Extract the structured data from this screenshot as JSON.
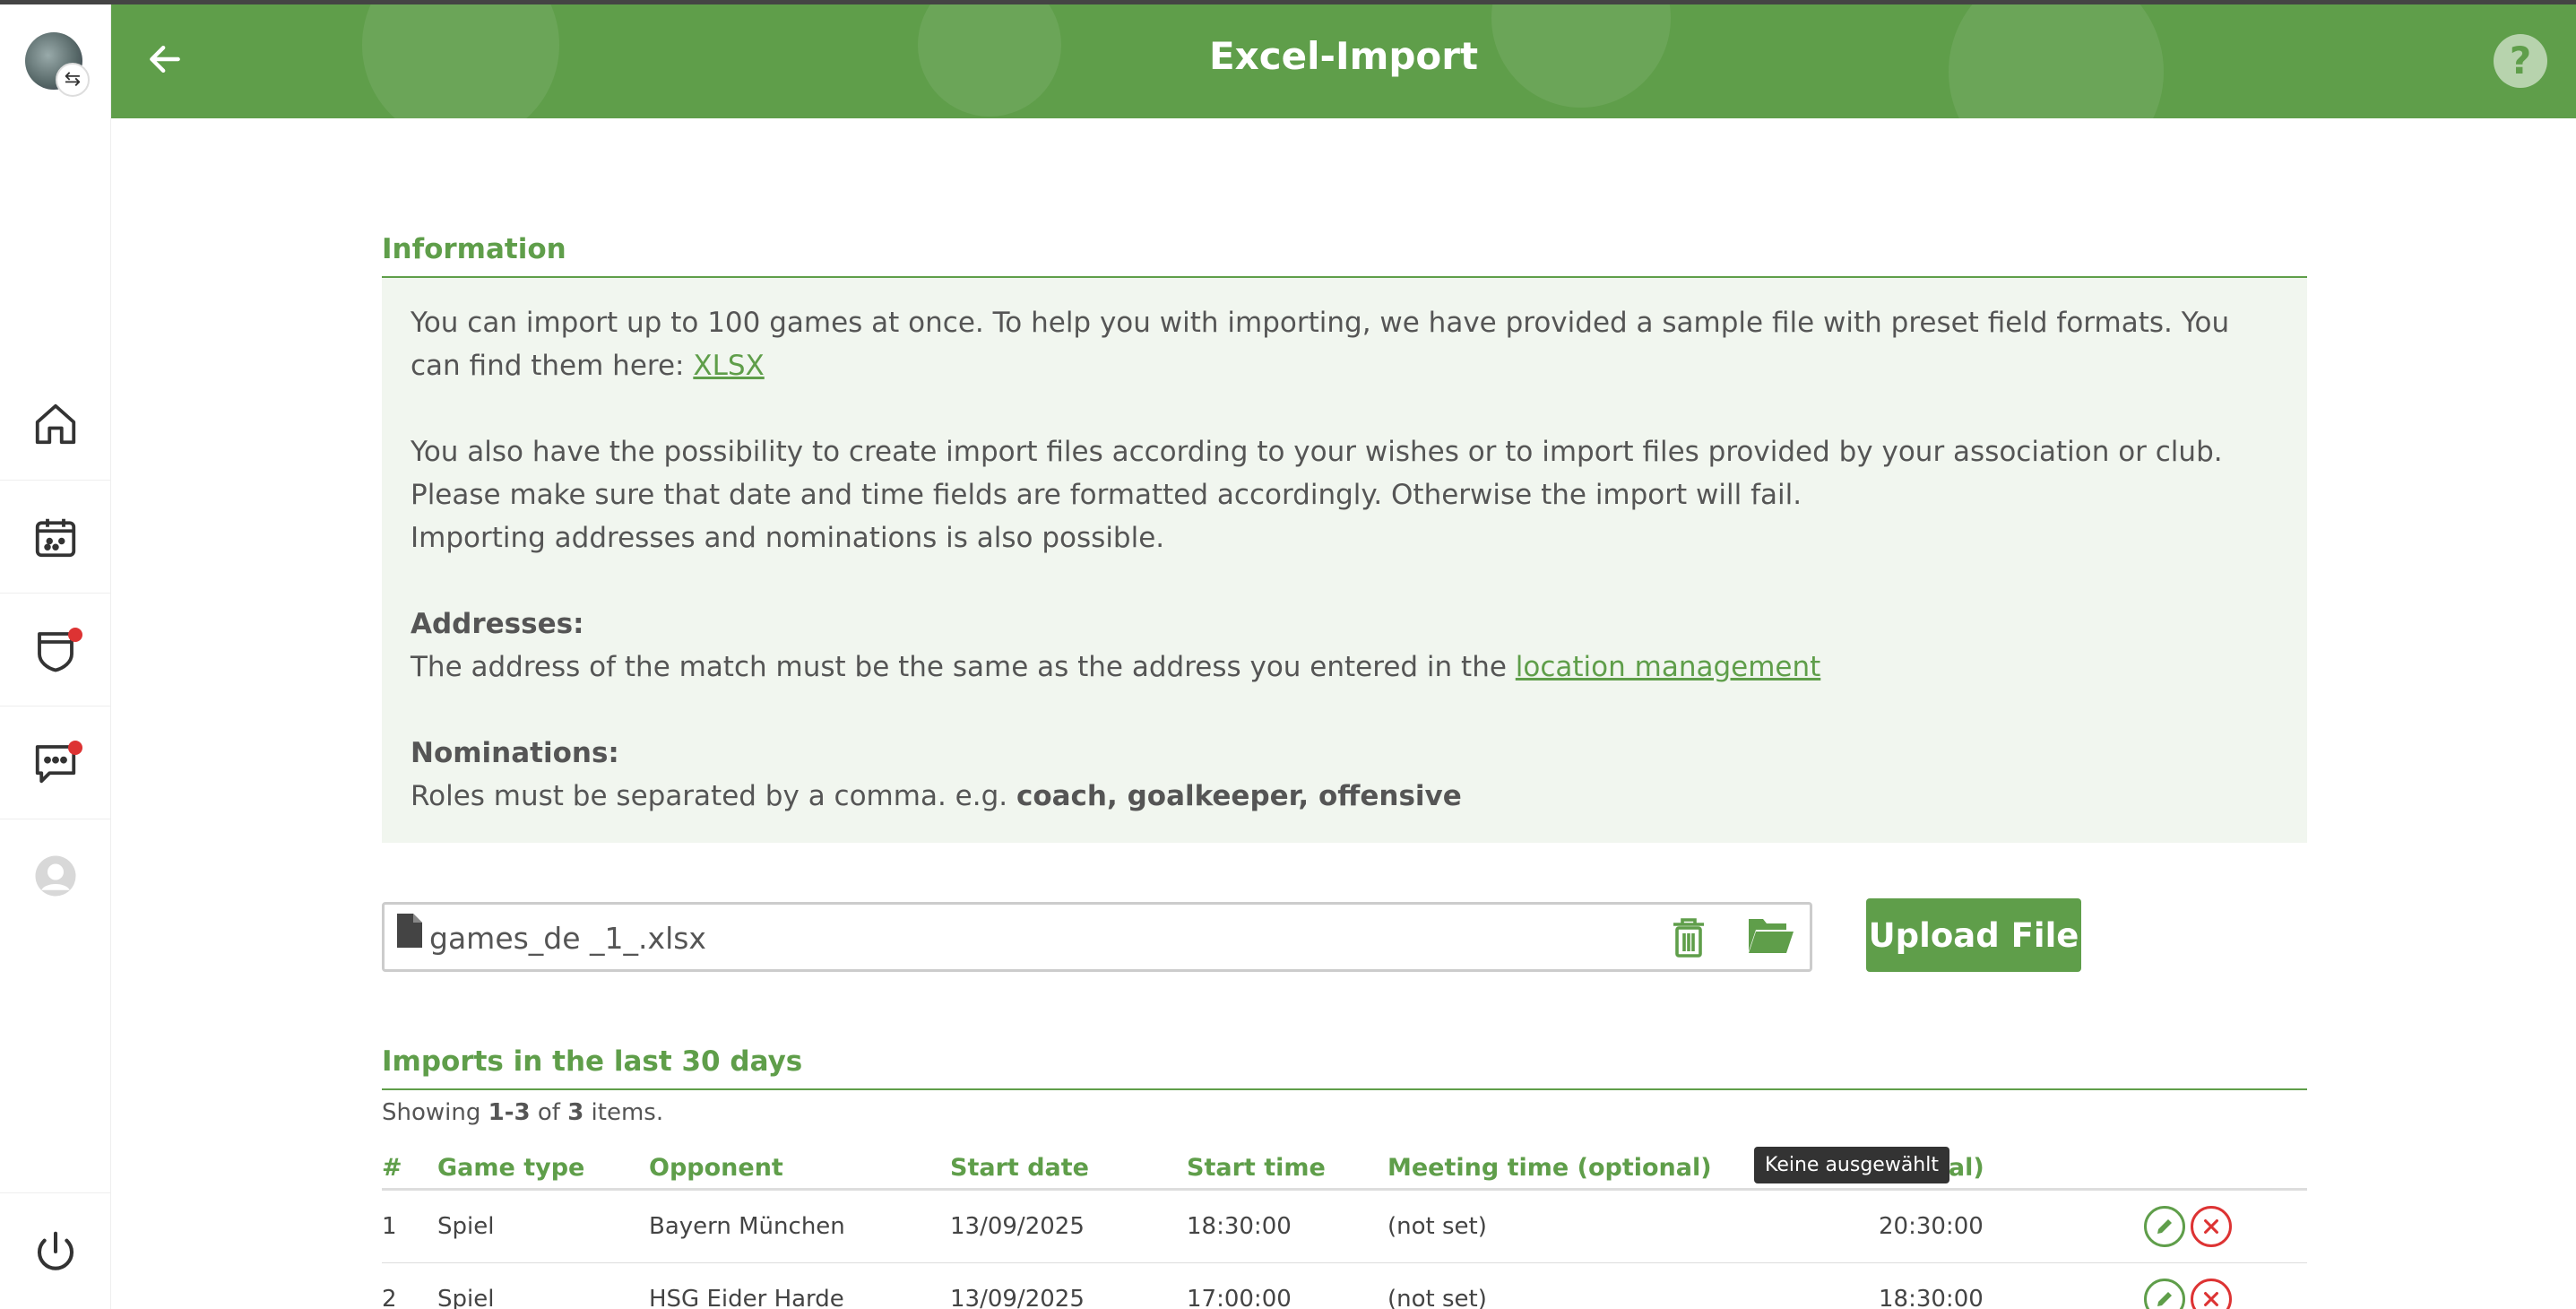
{
  "header": {
    "title": "Excel-Import",
    "help_label": "?"
  },
  "sidebar": {
    "swap_glyph": "⇆"
  },
  "info": {
    "title": "Information",
    "p1_text": "You can import up to 100 games at once. To help you with importing, we have provided a sample file with preset field formats. You can find them here: ",
    "p1_link": "XLSX",
    "p2": "You also have the possibility to create import files according to your wishes or to import files provided by your association or club. Please make sure that date and time fields are formatted accordingly. Otherwise the import will fail.",
    "p3": "Importing addresses and nominations is also possible.",
    "addresses_label": "Addresses:",
    "addresses_text": "The address of the match must be the same as the address you entered in the ",
    "addresses_link": "location management",
    "nominations_label": "Nominations:",
    "nominations_text": "Roles must be separated by a comma. e.g. ",
    "nominations_example": "coach, goalkeeper, offensive"
  },
  "upload": {
    "file_name": "games_de _1_.xlsx",
    "button_label": "Upload File"
  },
  "imports": {
    "title": "Imports in the last 30 days",
    "showing_prefix": "Showing ",
    "showing_range": "1-3",
    "showing_of": " of ",
    "showing_total": "3",
    "showing_suffix": " items.",
    "columns": [
      "#",
      "Game type",
      "Opponent",
      "Start date",
      "Start time",
      "Meeting time (optional)",
      "tional)"
    ],
    "rows": [
      {
        "num": "1",
        "type": "Spiel",
        "opponent": "Bayern München",
        "date": "13/09/2025",
        "time": "18:30:00",
        "meeting": "(not set)",
        "end": "20:30:00"
      },
      {
        "num": "2",
        "type": "Spiel",
        "opponent": "HSG Eider Harde",
        "date": "13/09/2025",
        "time": "17:00:00",
        "meeting": "(not set)",
        "end": "18:30:00"
      }
    ]
  },
  "tooltip": "Keine ausgewählt",
  "colors": {
    "brand_green": "#5f9e4a",
    "danger_red": "#dd3333"
  }
}
